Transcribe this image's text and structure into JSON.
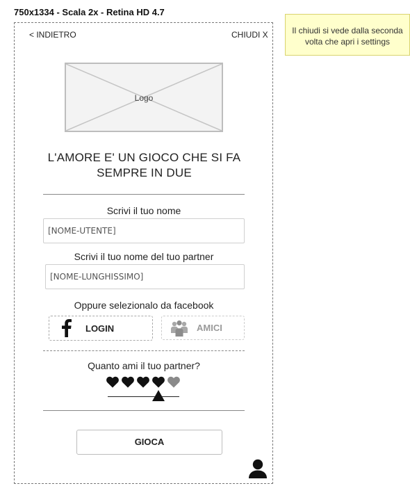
{
  "screen_title": "750x1334 - Scala 2x - Retina HD 4.7",
  "nav": {
    "back_label": "< INDIETRO",
    "close_label": "CHIUDI X"
  },
  "logo": {
    "label": "Logo"
  },
  "headline": "L'AMORE E' UN GIOCO CHE SI FA SEMPRE IN DUE",
  "form": {
    "name_label": "Scrivi il tuo nome",
    "name_value": "[NOME-UTENTE]",
    "partner_label": "Scrivi il tuo nome del tuo partner",
    "partner_value": "[NOME-LUNGHISSIMO]",
    "facebook_label": "Oppure selezionalo da facebook",
    "login_label": "LOGIN",
    "friends_label": "AMICI",
    "love_label": "Quanto ami il tuo partner?",
    "love_rating": 4,
    "love_rating_max": 5,
    "play_label": "GIOCA"
  },
  "note": "Il chiudi si vede dalla seconda volta che apri i settings",
  "colors": {
    "note_bg": "#ffffcc",
    "heart_filled": "#111111",
    "heart_empty": "#8a8a8a"
  },
  "icons": [
    "facebook-icon",
    "friends-icon",
    "heart-icon",
    "slider-thumb-icon",
    "user-icon"
  ]
}
